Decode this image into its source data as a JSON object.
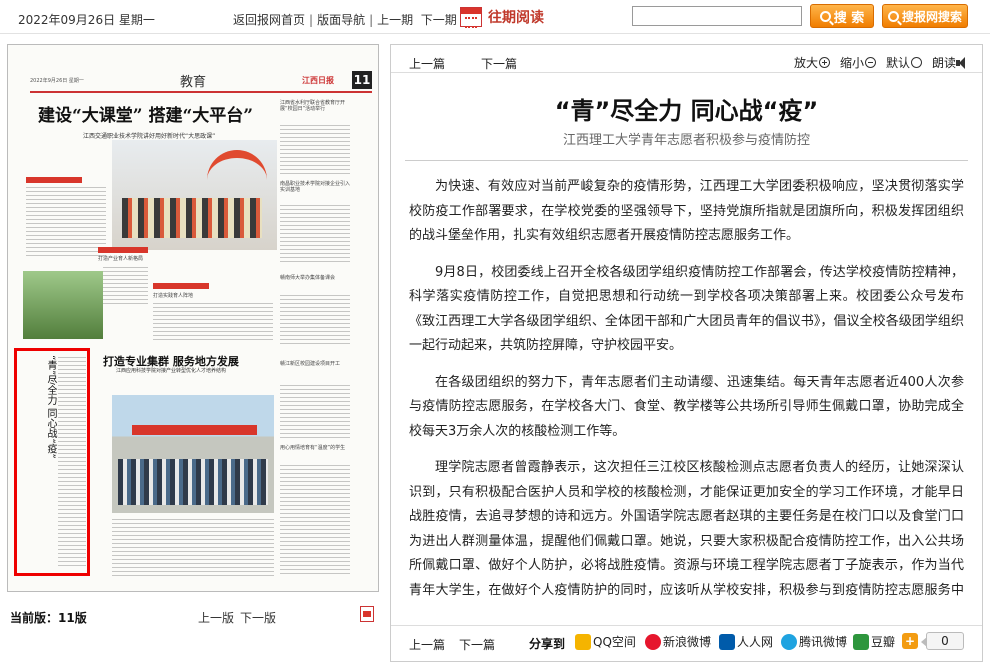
{
  "topbar": {
    "date": "2022年09月26日 星期一",
    "home": "返回报网首页",
    "pagenav": "版面导航",
    "prev": "上一期",
    "next": "下一期",
    "past": "往期阅读",
    "search": "搜 索",
    "search_site": "搜报网搜索"
  },
  "newspaper": {
    "date": "2022年9月26日 星期一",
    "section": "教育",
    "logo": "江西日报",
    "page_number": "11",
    "headline_main": "建设“大课堂” 搭建“大平台”",
    "headline_main_sub": "江西交通职业技术学院讲好用好新时代“大思政课”",
    "headline_second": "打造专业集群 服务地方发展",
    "headline_second_sub": "江西应用科技学院对接产业转型优化人才培养结构",
    "vertical_title": "“青”尽全力 同心战“疫”",
    "side_items": [
      "江西省水利厅联合省教育厅开展“校园日”活动举行",
      "南昌职业技术学院对接企业引入实训基地",
      "打造产业育人新格局",
      "打造实践育人阵地",
      "赣南师大举办集体备课会",
      "赣江新区校园建设项目开工",
      "用心用情培育有“温度”的学生"
    ]
  },
  "current_page": {
    "label": "当前版：11版",
    "prev": "上一版",
    "next": "下一版"
  },
  "article_toolbar": {
    "prev": "上一篇",
    "next": "下一篇",
    "zoom_in": "放大",
    "zoom_out": "缩小",
    "default": "默认",
    "read": "朗读"
  },
  "article": {
    "title": "“青”尽全力 同心战“疫”",
    "subtitle": "江西理工大学青年志愿者积极参与疫情防控",
    "paragraphs": [
      "为快速、有效应对当前严峻复杂的疫情形势，江西理工大学团委积极响应，坚决贯彻落实学校防疫工作部署要求，在学校党委的坚强领导下，坚持党旗所指就是团旗所向，积极发挥团组织的战斗堡垒作用，扎实有效组织志愿者开展疫情防控志愿服务工作。",
      "9月8日，校团委线上召开全校各级团学组织疫情防控工作部署会，传达学校疫情防控精神，科学落实疫情防控工作，自觉把思想和行动统一到学校各项决策部署上来。校团委公众号发布《致江西理工大学各级团学组织、全体团干部和广大团员青年的倡议书》，倡议全校各级团学组织一起行动起来，共筑防控屏障，守护校园平安。",
      "在各级团组织的努力下，青年志愿者们主动请缨、迅速集结。每天青年志愿者近400人次参与疫情防控志愿服务，在学校各大门、食堂、教学楼等公共场所引导师生佩戴口罩，协助完成全校每天3万余人次的核酸检测工作等。",
      "理学院志愿者曾霞静表示，这次担任三江校区核酸检测点志愿者负责人的经历，让她深深认识到，只有积极配合医护人员和学校的核酸检测，才能保证更加安全的学习工作环境，才能早日战胜疫情，去追寻梦想的诗和远方。外国语学院志愿者赵琪的主要任务是在校门口以及食堂门口为进出人群测量体温，提醒他们佩戴口罩。她说，只要大家积极配合疫情防控工作，出入公共场所佩戴口罩、做好个人防护，必将战胜疫情。资源与环境工程学院志愿者丁子旋表示，作为当代青年大学生，在做好个人疫情防护的同时，应该听从学校安排，积极参与到疫情防控志愿服务中去。"
    ]
  },
  "bottom": {
    "prev": "上一篇",
    "next": "下一篇",
    "share_label": "分享到",
    "share": [
      {
        "name": "QQ空间",
        "icon": "qzone-icon",
        "color": "#f5b400"
      },
      {
        "name": "新浪微博",
        "icon": "weibo-icon",
        "color": "#e6162d"
      },
      {
        "name": "人人网",
        "icon": "renren-icon",
        "color": "#005baa"
      },
      {
        "name": "腾讯微博",
        "icon": "tqq-icon",
        "color": "#1fa3e0"
      },
      {
        "name": "豆瓣",
        "icon": "douban-icon",
        "color": "#2e963d"
      }
    ],
    "more_icon": "plus-icon",
    "count": "0"
  },
  "colors": {
    "accent_red": "#c0392b",
    "orange_button": "#f08a00",
    "highlight_box": "#e00000"
  }
}
